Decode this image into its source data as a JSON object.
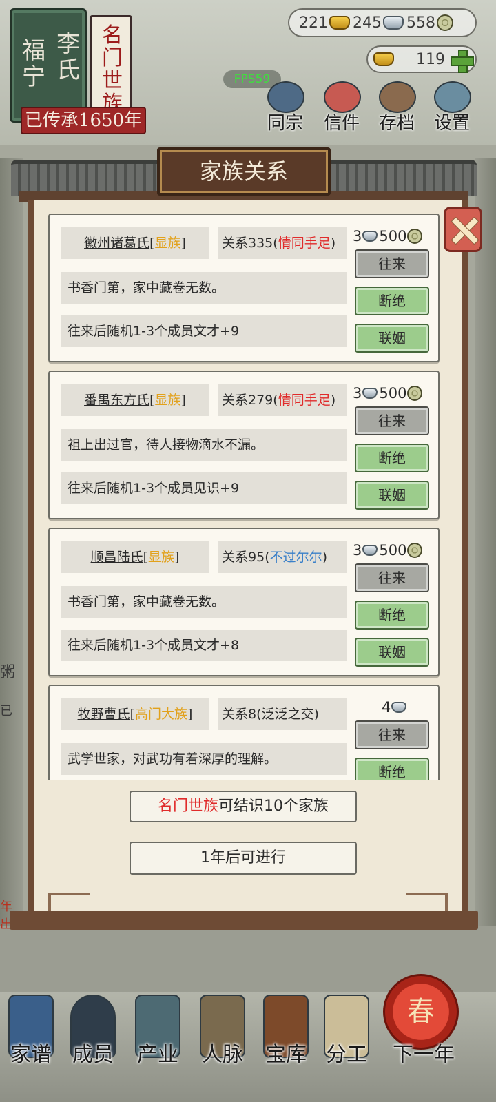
{
  "header": {
    "plaque_lines": [
      "福宁",
      "李氏"
    ],
    "rank_title": "名门世族",
    "heritage": "已传承1650年",
    "currency": {
      "gold": "221",
      "silver": "245",
      "coins": "558"
    },
    "ingots": "119",
    "fps": "FPS59",
    "menu": [
      {
        "label": "同宗",
        "icon": "books-icon"
      },
      {
        "label": "信件",
        "icon": "letter-icon"
      },
      {
        "label": "存档",
        "icon": "scroll-icon"
      },
      {
        "label": "设置",
        "icon": "gear-icon"
      }
    ]
  },
  "dialog": {
    "title": "家族关系",
    "families": [
      {
        "name": "徽州诸葛氏",
        "rank": "显族",
        "relation_label": "关系335",
        "relation_status": "情同手足",
        "relation_color": "#e02b2b",
        "description": "书香门第，家中藏卷无数。",
        "effect": "往来后随机1-3个成员文才+9",
        "cost_silver": "3",
        "cost_coins": "500",
        "buttons": {
          "visit": "往来",
          "break": "断绝",
          "marry": "联姻"
        }
      },
      {
        "name": "番禺东方氏",
        "rank": "显族",
        "relation_label": "关系279",
        "relation_status": "情同手足",
        "relation_color": "#e02b2b",
        "description": "祖上出过官，待人接物滴水不漏。",
        "effect": "往来后随机1-3个成员见识+9",
        "cost_silver": "3",
        "cost_coins": "500",
        "buttons": {
          "visit": "往来",
          "break": "断绝",
          "marry": "联姻"
        }
      },
      {
        "name": "顺昌陆氏",
        "rank": "显族",
        "relation_label": "关系95",
        "relation_status": "不过尔尔",
        "relation_color": "#3a80c9",
        "description": "书香门第，家中藏卷无数。",
        "effect": "往来后随机1-3个成员文才+8",
        "cost_silver": "3",
        "cost_coins": "500",
        "buttons": {
          "visit": "往来",
          "break": "断绝",
          "marry": "联姻"
        }
      },
      {
        "name": "牧野曹氏",
        "rank": "高门大族",
        "relation_label": "关系8",
        "relation_status": "泛泛之交",
        "relation_color": "#2a2a2a",
        "description": "武学世家，对武功有着深厚的理解。",
        "cost_silver": "4",
        "buttons": {
          "visit": "往来",
          "break": "断绝"
        }
      }
    ],
    "limit_rank": "名门世族",
    "limit_text": "可结识10个家族",
    "next_action": "1年后可进行"
  },
  "background_fragments": [
    "粥",
    "已",
    "年",
    "出"
  ],
  "bottom_nav": [
    {
      "label": "家谱",
      "icon": "genealogy-book-icon"
    },
    {
      "label": "成员",
      "icon": "member-portrait-icon"
    },
    {
      "label": "产业",
      "icon": "building-icon"
    },
    {
      "label": "人脉",
      "icon": "network-icon"
    },
    {
      "label": "宝库",
      "icon": "treasure-chest-icon"
    },
    {
      "label": "分工",
      "icon": "scroll-list-icon"
    },
    {
      "label": "下一年",
      "icon": "lantern-icon",
      "emblem": "春"
    }
  ]
}
